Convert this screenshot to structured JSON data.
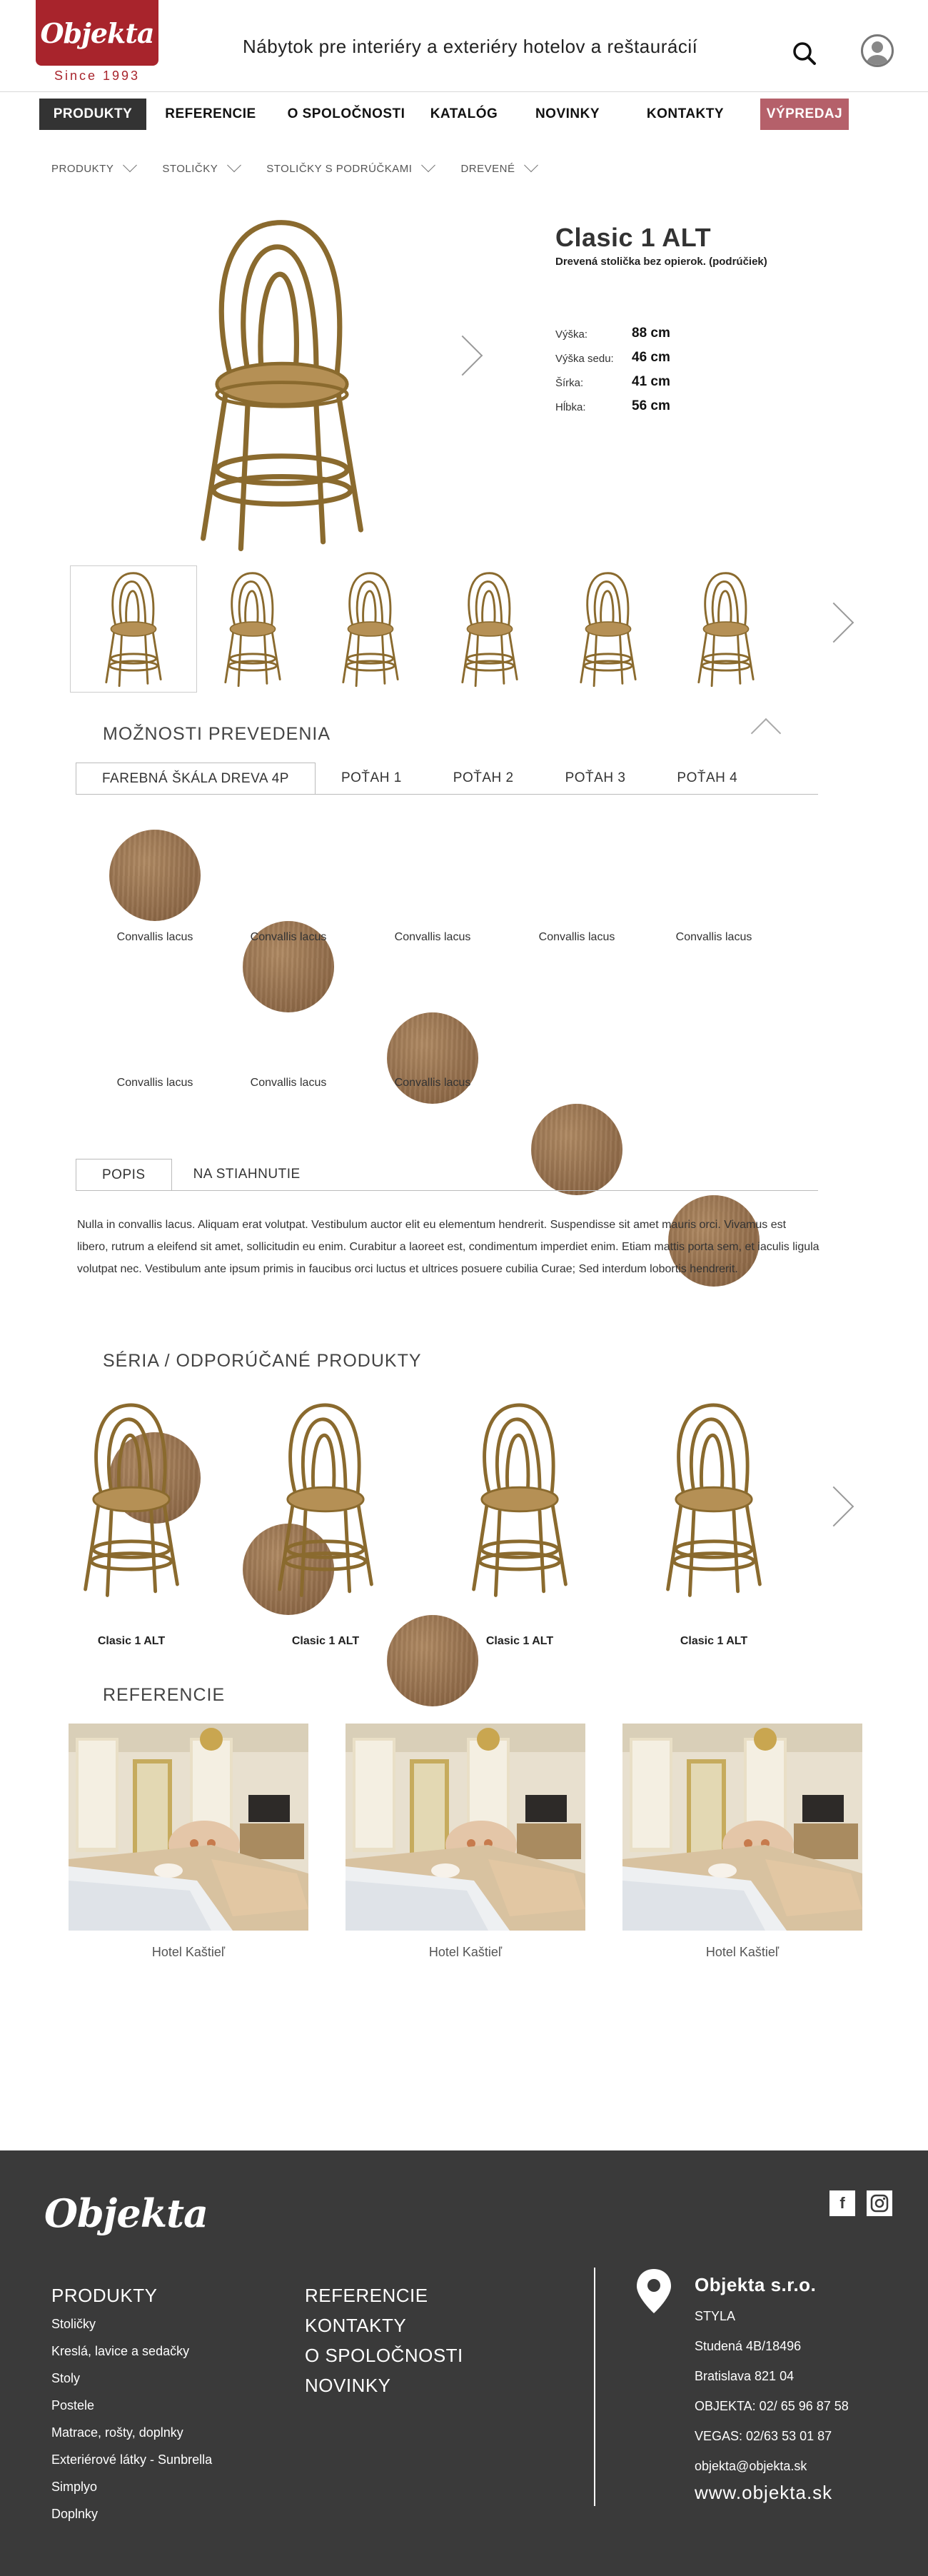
{
  "header": {
    "logo": "Objekta",
    "since": "Since 1993",
    "tagline": "Nábytok pre interiéry a exteriéry hotelov a reštaurácií"
  },
  "nav": [
    {
      "label": "PRODUKTY",
      "active": true
    },
    {
      "label": "REFERENCIE"
    },
    {
      "label": "O SPOLOČNOSTI"
    },
    {
      "label": "KATALÓG"
    },
    {
      "label": "NOVINKY"
    },
    {
      "label": "KONTAKTY"
    },
    {
      "label": "VÝPREDAJ",
      "sale": true
    }
  ],
  "breadcrumb": [
    "PRODUKTY",
    "STOLIČKY",
    "STOLIČKY S PODRÚČKAMI",
    "DREVENÉ"
  ],
  "product": {
    "title": "Clasic 1 ALT",
    "subtitle": "Drevená stolička bez opierok. (podrúčiek)",
    "specs": [
      {
        "label": "Výška:",
        "value": "88 cm"
      },
      {
        "label": "Výška sedu:",
        "value": "46 cm"
      },
      {
        "label": "Šírka:",
        "value": "41 cm"
      },
      {
        "label": "Hĺbka:",
        "value": "56 cm"
      }
    ]
  },
  "options": {
    "title": "MOŽNOSTI PREVEDENIA",
    "tabs": [
      "FAREBNÁ ŠKÁLA DREVA 4P",
      "POŤAH 1",
      "POŤAH 2",
      "POŤAH 3",
      "POŤAH 4"
    ],
    "swatches": [
      "Convallis lacus",
      "Convallis lacus",
      "Convallis lacus",
      "Convallis lacus",
      "Convallis lacus",
      "Convallis lacus",
      "Convallis lacus",
      "Convallis lacus"
    ]
  },
  "description": {
    "tabs": [
      "POPIS",
      "NA STIAHNUTIE"
    ],
    "text": "Nulla in convallis lacus. Aliquam erat volutpat. Vestibulum auctor elit eu elementum hendrerit. Suspendisse sit amet mauris orci. Vivamus est libero, rutrum a eleifend sit amet, sollicitudin eu enim. Curabitur a laoreet est, condimentum imperdiet enim. Etiam mattis porta sem, et iaculis ligula volutpat nec. Vestibulum ante ipsum primis in faucibus orci luctus et ultrices posuere cubilia Curae; Sed interdum lobortis hendrerit."
  },
  "series": {
    "title": "SÉRIA / ODPORÚČANÉ PRODUKTY",
    "items": [
      "Clasic 1 ALT",
      "Clasic 1 ALT",
      "Clasic 1 ALT",
      "Clasic 1 ALT"
    ]
  },
  "references": {
    "title": "REFERENCIE",
    "items": [
      "Hotel Kaštieľ",
      "Hotel Kaštieľ",
      "Hotel Kaštieľ"
    ]
  },
  "footer": {
    "logo": "Objekta",
    "social": [
      "f",
      "ig"
    ],
    "col1_head": "PRODUKTY",
    "col1_links": [
      "Stoličky",
      "Kreslá, lavice a sedačky",
      "Stoly",
      "Postele",
      "Matrace, rošty, doplnky",
      "Exteriérové látky - Sunbrella",
      "Simplyo",
      "Doplnky"
    ],
    "col2_links": [
      "REFERENCIE",
      "KONTAKTY",
      "O SPOLOČNOSTI",
      "NOVINKY"
    ],
    "company": "Objekta s.r.o.",
    "info": [
      "STYLA",
      "Studená 4B/18496",
      "Bratislava 821 04",
      "OBJEKTA: 02/ 65 96 87 58",
      "VEGAS: 02/63 53 01 87",
      "objekta@objekta.sk"
    ],
    "web": "www.objekta.sk"
  },
  "colors": {
    "brand": "#a8242c",
    "sale": "#b5606a",
    "footer": "#3a3a3a",
    "wood": "#8f6a48"
  }
}
